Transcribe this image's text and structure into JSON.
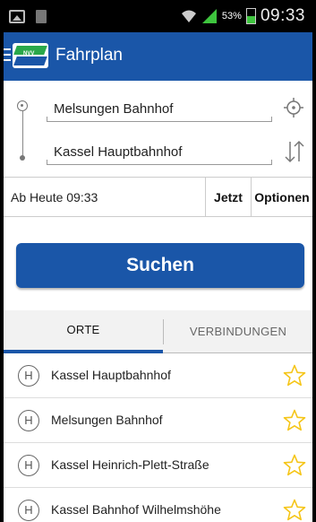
{
  "status_bar": {
    "battery": "53%",
    "time": "09:33"
  },
  "app_bar": {
    "title": "Fahrplan",
    "logo_text": "NVV"
  },
  "route": {
    "from": "Melsungen Bahnhof",
    "to": "Kassel Hauptbahnhof"
  },
  "time_row": {
    "label": "Ab  Heute 09:33",
    "now_label": "Jetzt",
    "options_label": "Optionen"
  },
  "search": {
    "label": "Suchen"
  },
  "tabs": [
    {
      "label": "ORTE",
      "active": true
    },
    {
      "label": "VERBINDUNGEN",
      "active": false
    }
  ],
  "places": [
    {
      "badge": "H",
      "name": "Kassel Hauptbahnhof"
    },
    {
      "badge": "H",
      "name": "Melsungen Bahnhof"
    },
    {
      "badge": "H",
      "name": "Kassel Heinrich-Plett-Straße"
    },
    {
      "badge": "H",
      "name": "Kassel Bahnhof Wilhelmshöhe"
    }
  ],
  "colors": {
    "primary": "#1a56a8",
    "accent_green": "#2aa84a",
    "star": "#f5c518"
  },
  "icons": {
    "locate": "crosshair-icon",
    "swap": "swap-arrows-icon",
    "favorite": "star-outline-icon",
    "stop": "h-stop-icon"
  }
}
